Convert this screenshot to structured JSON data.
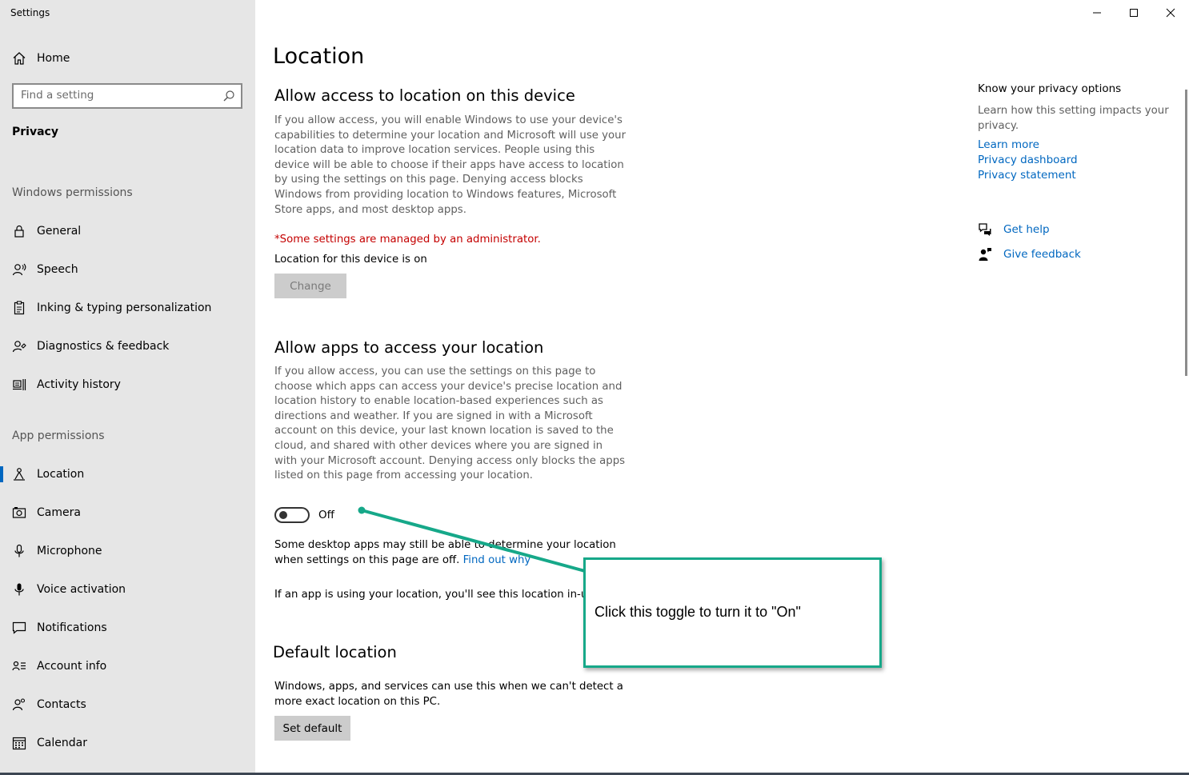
{
  "window": {
    "title": "Settings",
    "controls": [
      "minimize",
      "maximize",
      "close"
    ]
  },
  "sidebar": {
    "home_label": "Home",
    "search_placeholder": "Find a setting",
    "category": "Privacy",
    "windows_permissions_title": "Windows permissions",
    "windows_permissions": [
      {
        "label": "General",
        "icon": "lock-icon"
      },
      {
        "label": "Speech",
        "icon": "speech-icon"
      },
      {
        "label": "Inking & typing personalization",
        "icon": "clipboard-icon"
      },
      {
        "label": "Diagnostics & feedback",
        "icon": "diagnostics-icon"
      },
      {
        "label": "Activity history",
        "icon": "activity-icon"
      }
    ],
    "app_permissions_title": "App permissions",
    "app_permissions": [
      {
        "label": "Location",
        "icon": "location-icon",
        "active": true
      },
      {
        "label": "Camera",
        "icon": "camera-icon"
      },
      {
        "label": "Microphone",
        "icon": "microphone-icon"
      },
      {
        "label": "Voice activation",
        "icon": "voice-icon"
      },
      {
        "label": "Notifications",
        "icon": "notifications-icon"
      },
      {
        "label": "Account info",
        "icon": "account-icon"
      },
      {
        "label": "Contacts",
        "icon": "contacts-icon"
      },
      {
        "label": "Calendar",
        "icon": "calendar-icon"
      }
    ]
  },
  "main": {
    "title": "Location",
    "device_section": {
      "heading": "Allow access to location on this device",
      "description": "If you allow access, you will enable Windows to use your device's capabilities to determine your location and Microsoft will use your location data to improve location services. People using this device will be able to choose if their apps have access to location by using the settings on this page. Denying access blocks Windows from providing location to Windows features, Microsoft Store apps, and most desktop apps.",
      "admin_notice": "*Some settings are managed by an administrator.",
      "status": "Location for this device is on",
      "change_button": "Change"
    },
    "apps_section": {
      "heading": "Allow apps to access your location",
      "description": "If you allow access, you can use the settings on this page to choose which apps can access your device's precise location and location history to enable location-based experiences such as directions and weather. If you are signed in with a Microsoft account on this device, your last known location is saved to the cloud, and shared with other devices where you are signed in with your Microsoft account. Denying access only blocks the apps listed on this page from accessing your location.",
      "toggle_state": "Off",
      "desktop_note": "Some desktop apps may still be able to determine your location when settings on this page are off.",
      "find_out_why": "Find out why",
      "in_use_note": "If an app is using your location, you'll see this location in-use icon:"
    },
    "default_section": {
      "heading": "Default location",
      "description": "Windows, apps, and services can use this when we can't detect a more exact location on this PC.",
      "set_default_button": "Set default"
    }
  },
  "right_column": {
    "title": "Know your privacy options",
    "description": "Learn how this setting impacts your privacy.",
    "links": [
      "Learn more",
      "Privacy dashboard",
      "Privacy statement"
    ],
    "get_help": "Get help",
    "give_feedback": "Give feedback"
  },
  "annotation": {
    "text": "Click this toggle to turn it to \"On\"",
    "color": "#16a889"
  },
  "colors": {
    "accent": "#0067c0",
    "sidebar_bg": "#e6e6e6",
    "admin_red": "#c40000"
  }
}
